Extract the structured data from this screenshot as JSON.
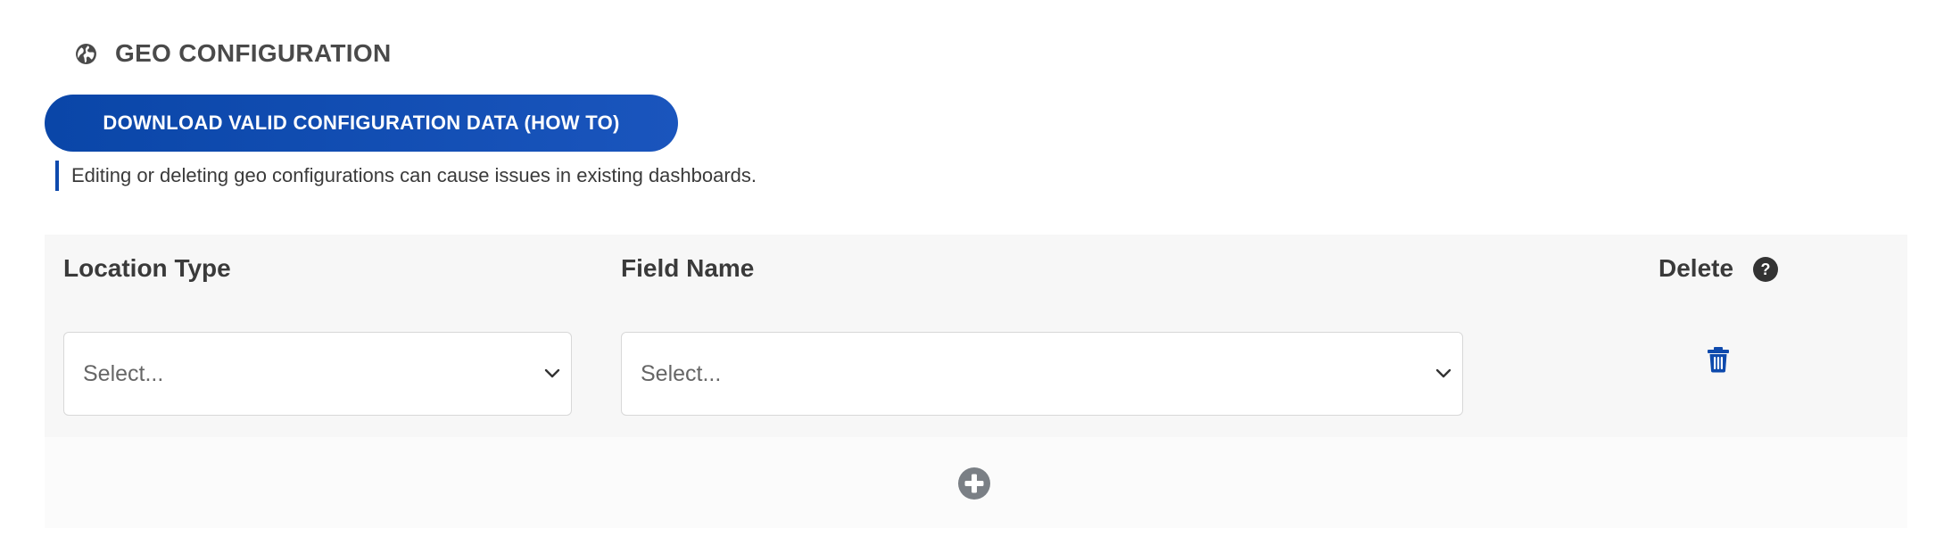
{
  "section": {
    "icon": "globe-icon",
    "title": "GEO CONFIGURATION"
  },
  "download_button": {
    "label": "DOWNLOAD VALID CONFIGURATION DATA (HOW TO)"
  },
  "notice": {
    "text": "Editing or deleting geo configurations can cause issues in existing dashboards."
  },
  "table": {
    "columns": {
      "location_type": "Location Type",
      "field_name": "Field Name",
      "delete": "Delete"
    },
    "help_icon_label": "?",
    "rows": [
      {
        "location_type": {
          "placeholder": "Select...",
          "icon": "chevron-down-icon"
        },
        "field_name": {
          "placeholder": "Select...",
          "icon": "chevron-down-icon"
        },
        "delete_icon": "trash-icon"
      }
    ],
    "add_icon": "plus-circle-icon"
  },
  "colors": {
    "accent": "#0E4AAD",
    "panel_bg": "#F7F7F7",
    "help_icon_bg": "#333333",
    "add_icon": "#7A7F85"
  }
}
